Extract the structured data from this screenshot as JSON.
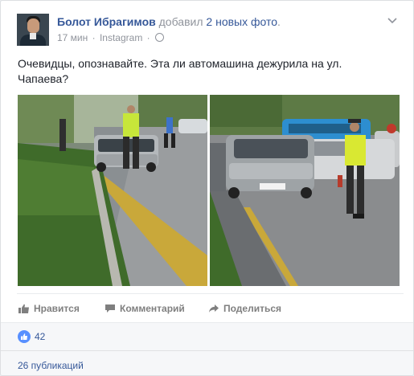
{
  "post": {
    "author": "Болот Ибрагимов",
    "action_prefix": "добавил",
    "action_link": "2 новых фото",
    "action_suffix": ".",
    "time": "17 мин",
    "via": "Instagram",
    "privacy_icon": "globe-icon",
    "text": "Очевидцы, опознавайте. Эта ли автомашина дежурила на ул. Чапаева?"
  },
  "actions": {
    "like": "Нравится",
    "comment": "Комментарий",
    "share": "Поделиться"
  },
  "reactions": {
    "count": "42"
  },
  "shares": {
    "text": "26 публикаций"
  },
  "colors": {
    "link": "#365899",
    "like_blue": "#5890ff",
    "muted": "#90949c"
  }
}
